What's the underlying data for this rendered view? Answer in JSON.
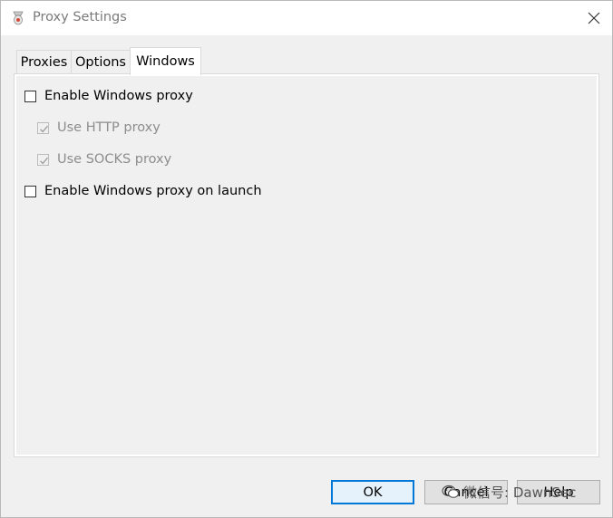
{
  "window": {
    "title": "Proxy Settings",
    "app_icon": "proxy-app-icon",
    "close_icon": "close-icon"
  },
  "tabs": [
    {
      "label": "Proxies",
      "active": false
    },
    {
      "label": "Options",
      "active": false
    },
    {
      "label": "Windows",
      "active": true
    }
  ],
  "windows_tab": {
    "enable_windows_proxy": {
      "label": "Enable Windows proxy",
      "checked": false,
      "enabled": true
    },
    "use_http_proxy": {
      "label": "Use HTTP proxy",
      "checked": true,
      "enabled": false
    },
    "use_socks_proxy": {
      "label": "Use SOCKS proxy",
      "checked": true,
      "enabled": false
    },
    "enable_on_launch": {
      "label": "Enable Windows proxy on launch",
      "checked": false,
      "enabled": true
    }
  },
  "buttons": {
    "ok": "OK",
    "cancel": "Cancel",
    "help": "Help"
  },
  "watermark": {
    "text": "微信号: DawnSec",
    "icon": "wechat-icon"
  },
  "colors": {
    "accent": "#0078d7",
    "dialog_bg": "#f0f0f0",
    "disabled_text": "#8d8d8d"
  }
}
